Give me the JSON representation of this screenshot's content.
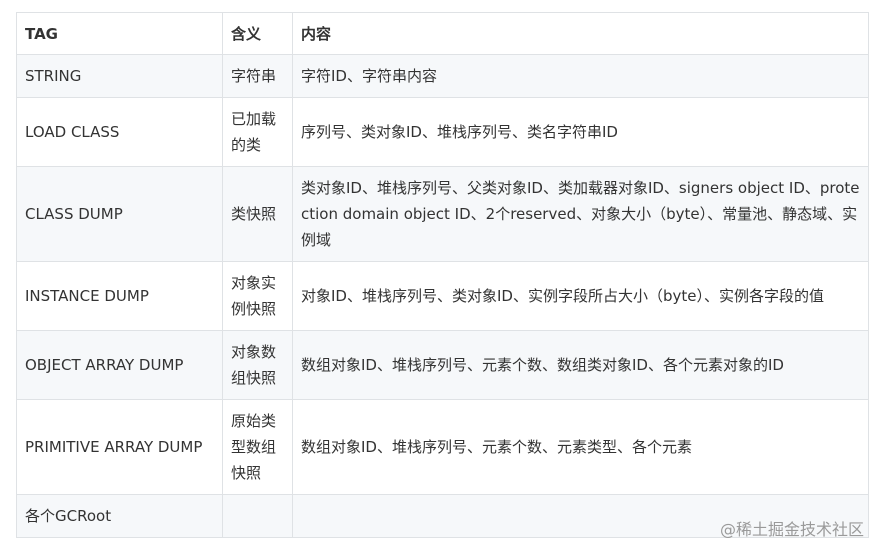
{
  "table": {
    "headers": [
      "TAG",
      "含义",
      "内容"
    ],
    "rows": [
      {
        "tag": "STRING",
        "meaning": "字符串",
        "content": "字符ID、字符串内容"
      },
      {
        "tag": "LOAD CLASS",
        "meaning": "已加载的类",
        "content": "序列号、类对象ID、堆栈序列号、类名字符串ID"
      },
      {
        "tag": "CLASS DUMP",
        "meaning": "类快照",
        "content": "类对象ID、堆栈序列号、父类对象ID、类加载器对象ID、signers object ID、protection domain object ID、2个reserved、对象大小（byte）、常量池、静态域、实例域"
      },
      {
        "tag": "INSTANCE DUMP",
        "meaning": "对象实例快照",
        "content": "对象ID、堆栈序列号、类对象ID、实例字段所占大小（byte）、实例各字段的值"
      },
      {
        "tag": "OBJECT ARRAY DUMP",
        "meaning": "对象数组快照",
        "content": "数组对象ID、堆栈序列号、元素个数、数组类对象ID、各个元素对象的ID"
      },
      {
        "tag": "PRIMITIVE ARRAY DUMP",
        "meaning": "原始类型数组快照",
        "content": "数组对象ID、堆栈序列号、元素个数、元素类型、各个元素"
      },
      {
        "tag": "各个GCRoot",
        "meaning": "",
        "content": ""
      }
    ]
  },
  "watermark": "@稀土掘金技术社区"
}
